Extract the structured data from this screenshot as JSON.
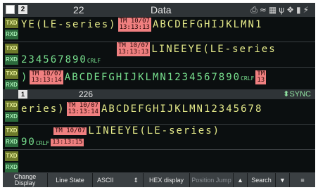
{
  "header": {
    "page_number": "2",
    "line_count": "22",
    "title": "Data",
    "status_icons": [
      "printer-icon",
      "wifi-icon",
      "network-icon",
      "usb-icon",
      "settings-icon",
      "sd-card-icon",
      "power-icon"
    ]
  },
  "badges": {
    "txd": "TXD",
    "rxd": "RXD"
  },
  "top_rows": [
    {
      "text": "YE(LE-series)",
      "ts_date": "TM 10/07",
      "ts_time": "13:13:13",
      "text2": "ABCDEFGHIJKLMN1"
    },
    {
      "text": "234567890",
      "crlf": "CRLF",
      "ts_date": "TM 10/07",
      "ts_time": "13:13:13",
      "text2": "LINEEYE(LE-series"
    },
    {
      "text": ")",
      "ts_date": "TM 10/07",
      "ts_time": "13:13:14",
      "text2": "ABCDEFGHIJKLMN1234567890",
      "crlf": "CRLF",
      "ts_date2": "TM",
      "ts_time2": "13"
    }
  ],
  "separator": {
    "page_number": "1",
    "line_count": "226",
    "sync_label": "SYNC"
  },
  "bottom_rows": [
    {
      "text": "eries)",
      "ts_date": "TM 10/07",
      "ts_time": "13:13:14",
      "text2": "ABCDEFGHIJKLMN12345678"
    },
    {
      "text": "90",
      "crlf": "CRLF",
      "ts_date": "TM 10/07",
      "ts_time": "13:13:15",
      "text2": "LINEEYE(LE-series)"
    }
  ],
  "toolbar": {
    "change_display": "Change Display",
    "line_state": "Line State",
    "ascii": "ASCII",
    "hex_display": "HEX display",
    "position_jump": "Position Jump",
    "search": "Search"
  }
}
